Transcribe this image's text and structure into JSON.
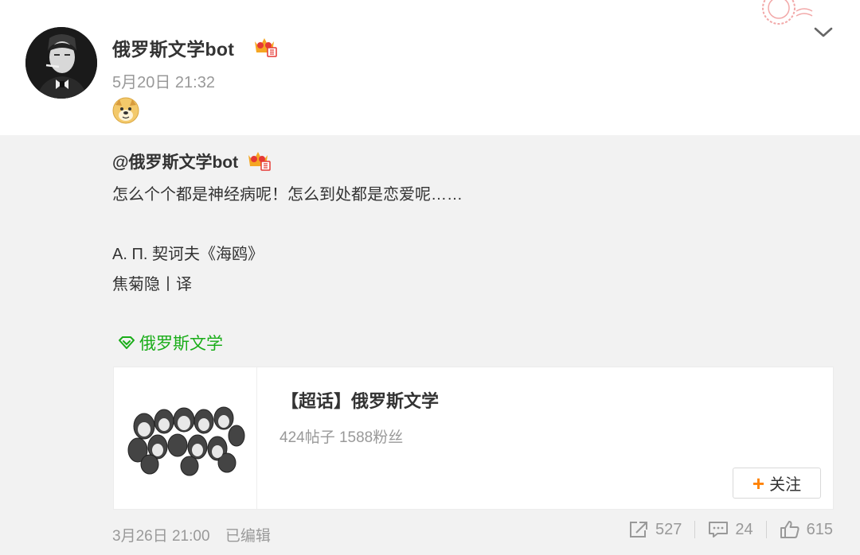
{
  "post": {
    "author": "俄罗斯文学bot",
    "time": "5月20日 21:32",
    "badge_icon": "crown-vip-icon",
    "emoji_icon": "doge-emoji-icon"
  },
  "repost": {
    "author": "@俄罗斯文学bot",
    "text_line1": "怎么个个都是神经病呢！怎么到处都是恋爱呢……",
    "text_line2": "А. П. 契诃夫《海鸥》",
    "text_line3": "焦菊隐丨译",
    "topic_tag": "俄罗斯文学",
    "card": {
      "title": "【超话】俄罗斯文学",
      "stats": "424帖子 1588粉丝",
      "follow_label": "关注"
    },
    "footer": {
      "time": "3月26日 21:00",
      "edited": "已编辑",
      "reposts": "527",
      "comments": "24",
      "likes": "615"
    }
  },
  "colors": {
    "topic_green": "#1aad19",
    "follow_plus": "#ff8200",
    "repost_bg": "#f2f2f2"
  }
}
